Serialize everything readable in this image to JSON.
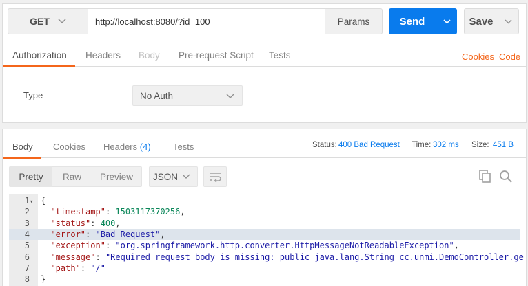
{
  "request": {
    "method": "GET",
    "url": "http://localhost:8080/?id=100",
    "params_label": "Params",
    "send_label": "Send",
    "save_label": "Save"
  },
  "request_tabs": [
    "Authorization",
    "Headers",
    "Body",
    "Pre-request Script",
    "Tests"
  ],
  "request_links": {
    "cookies": "Cookies",
    "code": "Code"
  },
  "auth": {
    "type_label": "Type",
    "type_value": "No Auth"
  },
  "response_tabs": {
    "body": "Body",
    "cookies": "Cookies",
    "headers": "Headers",
    "headers_count": "(4)",
    "tests": "Tests"
  },
  "status": {
    "status_label": "Status:",
    "status_value": "400 Bad Request",
    "time_label": "Time:",
    "time_value": "302 ms",
    "size_label": "Size:",
    "size_value": "451 B"
  },
  "view_modes": [
    "Pretty",
    "Raw",
    "Preview"
  ],
  "format": "JSON",
  "code_lines": [
    {
      "n": "1",
      "parts": [
        [
          "p",
          "{"
        ]
      ]
    },
    {
      "n": "2",
      "parts": [
        [
          "p",
          "  "
        ],
        [
          "k",
          "\"timestamp\""
        ],
        [
          "p",
          ": "
        ],
        [
          "n",
          "1503117370256"
        ],
        [
          "p",
          ","
        ]
      ]
    },
    {
      "n": "3",
      "parts": [
        [
          "p",
          "  "
        ],
        [
          "k",
          "\"status\""
        ],
        [
          "p",
          ": "
        ],
        [
          "n",
          "400"
        ],
        [
          "p",
          ","
        ]
      ]
    },
    {
      "n": "4",
      "parts": [
        [
          "p",
          "  "
        ],
        [
          "k",
          "\"error\""
        ],
        [
          "p",
          ": "
        ],
        [
          "s",
          "\"Bad Request\""
        ],
        [
          "p",
          ","
        ]
      ]
    },
    {
      "n": "5",
      "parts": [
        [
          "p",
          "  "
        ],
        [
          "k",
          "\"exception\""
        ],
        [
          "p",
          ": "
        ],
        [
          "s",
          "\"org.springframework.http.converter.HttpMessageNotReadableException\""
        ],
        [
          "p",
          ","
        ]
      ]
    },
    {
      "n": "6",
      "parts": [
        [
          "p",
          "  "
        ],
        [
          "k",
          "\"message\""
        ],
        [
          "p",
          ": "
        ],
        [
          "s",
          "\"Required request body is missing: public java.lang.String cc.unmi.DemoController.ge"
        ]
      ]
    },
    {
      "n": "7",
      "parts": [
        [
          "p",
          "  "
        ],
        [
          "k",
          "\"path\""
        ],
        [
          "p",
          ": "
        ],
        [
          "s",
          "\"/\""
        ]
      ]
    },
    {
      "n": "8",
      "parts": [
        [
          "p",
          "}"
        ]
      ]
    }
  ]
}
